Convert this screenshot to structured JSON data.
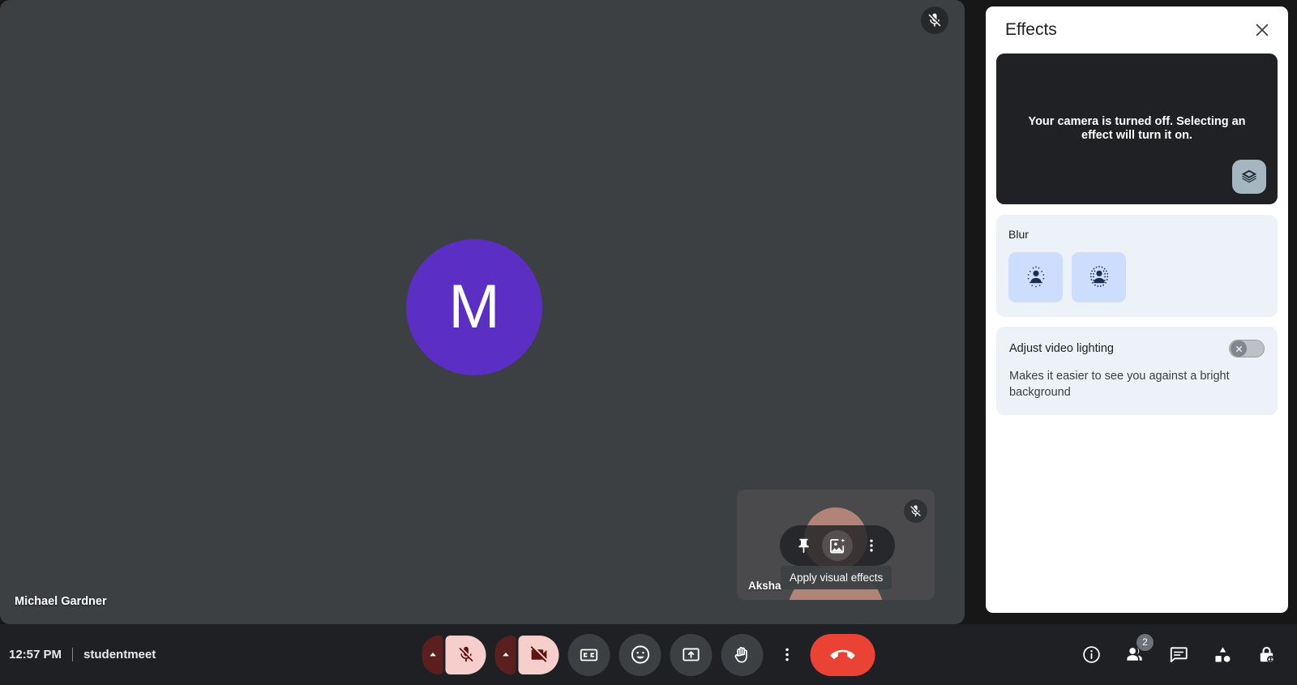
{
  "meeting": {
    "time": "12:57 PM",
    "code": "studentmeet"
  },
  "stage": {
    "main_participant": {
      "name": "Michael Gardner",
      "avatar_letter": "M",
      "avatar_color": "#5b2ec4",
      "mic_icon": "mic-off-icon",
      "muted": true
    },
    "self_view": {
      "name": "Aksha",
      "mic_icon": "mic-off-icon",
      "muted": true,
      "hover_actions": [
        {
          "name": "pin-icon",
          "label": "Pin"
        },
        {
          "name": "apply-visual-effects-icon",
          "label": "Apply visual effects",
          "active": true
        },
        {
          "name": "more-options-icon",
          "label": "More options"
        }
      ],
      "tooltip": "Apply visual effects"
    }
  },
  "toolbar": {
    "mic": {
      "name": "microphone-off-button",
      "icon": "mic-off-icon",
      "state": "off",
      "chevron": "chevron-up-icon"
    },
    "camera": {
      "name": "camera-off-button",
      "icon": "video-camera-off-icon",
      "state": "off",
      "chevron": "chevron-up-icon"
    },
    "captions": {
      "name": "captions-button",
      "icon": "closed-captions-icon",
      "label": "Turn on captions"
    },
    "reactions": {
      "name": "reactions-button",
      "icon": "emoji-smiley-icon",
      "label": "Send a reaction"
    },
    "present": {
      "name": "present-now-button",
      "icon": "present-screen-icon",
      "label": "Present now"
    },
    "raise_hand": {
      "name": "raise-hand-button",
      "icon": "raised-hand-icon",
      "label": "Raise hand"
    },
    "more": {
      "name": "more-options-button",
      "icon": "more-vertical-icon",
      "label": "More options"
    },
    "leave": {
      "name": "leave-call-button",
      "icon": "end-call-icon",
      "label": "Leave call"
    }
  },
  "right_controls": [
    {
      "name": "meeting-details-button",
      "icon": "info-icon",
      "label": "Meeting details",
      "badge": ""
    },
    {
      "name": "people-button",
      "icon": "people-icon",
      "label": "People",
      "badge": "2"
    },
    {
      "name": "chat-button",
      "icon": "chat-bubble-icon",
      "label": "Chat with everyone",
      "badge": ""
    },
    {
      "name": "activities-button",
      "icon": "activities-shapes-icon",
      "label": "Activities",
      "badge": ""
    },
    {
      "name": "host-controls-button",
      "icon": "lock-shield-icon",
      "label": "Host controls",
      "badge": ""
    }
  ],
  "effects_panel": {
    "title": "Effects",
    "close_icon": "close-icon",
    "preview": {
      "message": "Your camera is turned off. Selecting an effect will turn it on.",
      "layers_button": {
        "name": "layers-icon",
        "label": "Backgrounds and effects"
      }
    },
    "blur": {
      "label": "Blur",
      "options": [
        {
          "name": "slight-blur-option",
          "icon": "person-slight-blur-icon",
          "label": "Slightly blur your background"
        },
        {
          "name": "full-blur-option",
          "icon": "person-full-blur-icon",
          "label": "Blur your background"
        }
      ]
    },
    "lighting": {
      "title": "Adjust video lighting",
      "description": "Makes it easier to see you against a bright background",
      "toggle_state": "off",
      "toggle_icon": "close-x-icon"
    }
  }
}
